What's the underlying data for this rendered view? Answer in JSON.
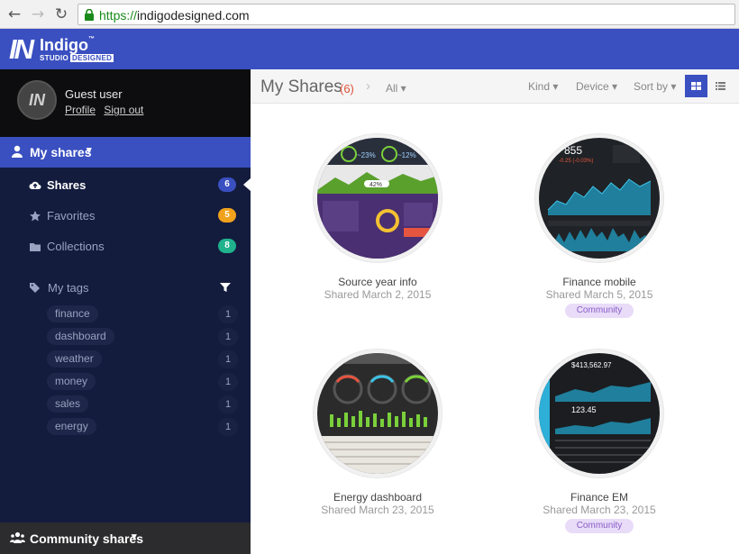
{
  "browser": {
    "url_scheme": "https://",
    "url_host": "indigodesigned.com"
  },
  "brand": {
    "mark": "IN",
    "name": "Indigo",
    "tm": "™",
    "sub_studio": "STUDIO",
    "sub_designed": "DESIGNED"
  },
  "user": {
    "initials": "IN",
    "name": "Guest user",
    "profile_link": "Profile",
    "signout_link": "Sign out"
  },
  "sidebar": {
    "section_label": "My shares",
    "items": [
      {
        "label": "Shares",
        "count": "6",
        "color": "#3a4fc0"
      },
      {
        "label": "Favorites",
        "count": "5",
        "color": "#f0a21c"
      },
      {
        "label": "Collections",
        "count": "8",
        "color": "#1fb28d"
      }
    ],
    "tags_label": "My tags",
    "tags": [
      {
        "label": "finance",
        "count": "1"
      },
      {
        "label": "dashboard",
        "count": "1"
      },
      {
        "label": "weather",
        "count": "1"
      },
      {
        "label": "money",
        "count": "1"
      },
      {
        "label": "sales",
        "count": "1"
      },
      {
        "label": "energy",
        "count": "1"
      }
    ],
    "community_label": "Community shares"
  },
  "toolbar": {
    "title": "My Shares",
    "count": "(6)",
    "filter": "All",
    "kind": "Kind",
    "device": "Device",
    "sort": "Sort by"
  },
  "cards": [
    {
      "title": "Source year info",
      "date": "Shared March 2, 2015",
      "badge": "",
      "thumb_readout_1": "~23%",
      "thumb_readout_2": "~12%",
      "thumb_readout_3": "42%"
    },
    {
      "title": "Finance mobile",
      "date": "Shared March 5, 2015",
      "badge": "Community",
      "thumb_readout_1": "855",
      "thumb_readout_2": "-0.25 (-0.03%)"
    },
    {
      "title": "Energy dashboard",
      "date": "Shared March 23, 2015",
      "badge": ""
    },
    {
      "title": "Finance EM",
      "date": "Shared March 23, 2015",
      "badge": "Community",
      "thumb_readout_1": "$413,562.97",
      "thumb_readout_2": "123.45"
    }
  ],
  "colors": {
    "brand": "#3a4fc0",
    "sidebar": "#141c3e",
    "danger": "#e0523a"
  }
}
